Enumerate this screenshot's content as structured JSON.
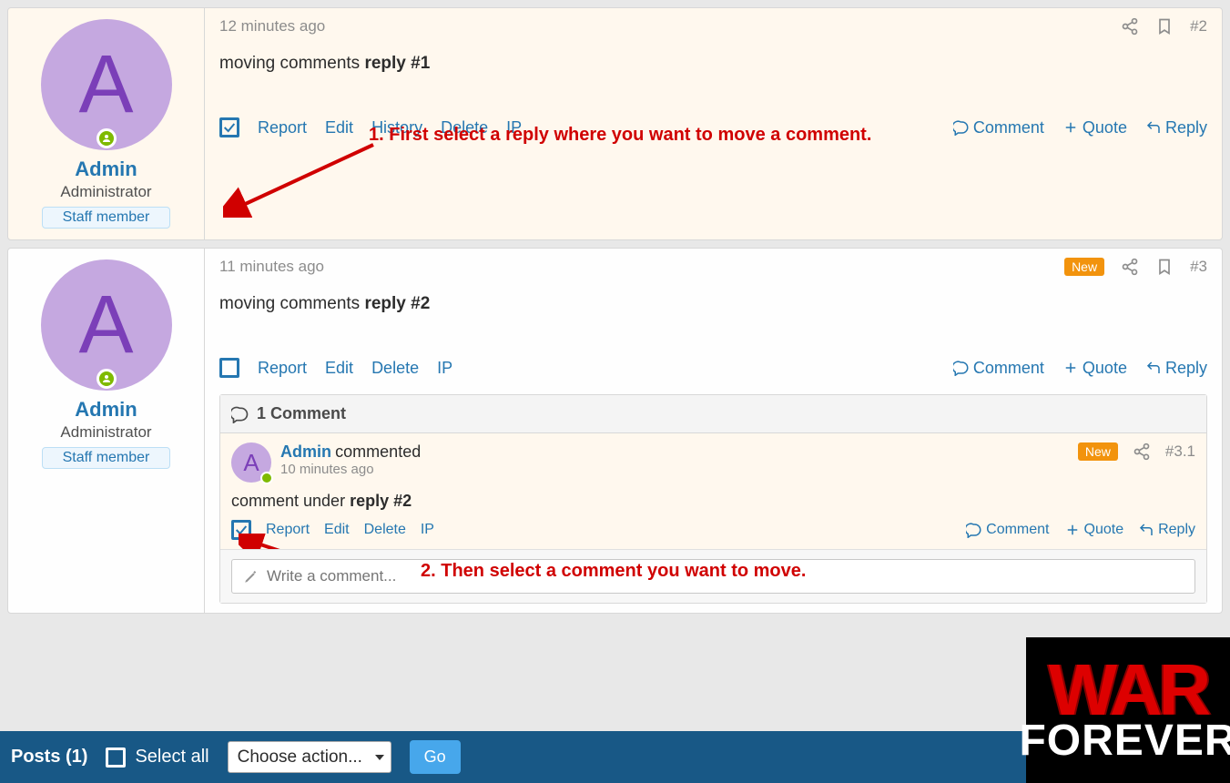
{
  "posts": [
    {
      "avatar_letter": "A",
      "username": "Admin",
      "usertitle": "Administrator",
      "staff_badge": "Staff member",
      "time": "12 minutes ago",
      "postnum": "#2",
      "new_badge": null,
      "body_prefix": "moving comments ",
      "body_bold": "reply #1",
      "checked": true,
      "actions_left": [
        "Report",
        "Edit",
        "History",
        "Delete",
        "IP"
      ],
      "actions_right": [
        {
          "icon": "comment",
          "label": "Comment"
        },
        {
          "icon": "plus",
          "label": "Quote"
        },
        {
          "icon": "reply",
          "label": "Reply"
        }
      ]
    },
    {
      "avatar_letter": "A",
      "username": "Admin",
      "usertitle": "Administrator",
      "staff_badge": "Staff member",
      "time": "11 minutes ago",
      "postnum": "#3",
      "new_badge": "New",
      "body_prefix": "moving comments ",
      "body_bold": "reply #2",
      "checked": false,
      "actions_left": [
        "Report",
        "Edit",
        "Delete",
        "IP"
      ],
      "actions_right": [
        {
          "icon": "comment",
          "label": "Comment"
        },
        {
          "icon": "plus",
          "label": "Quote"
        },
        {
          "icon": "reply",
          "label": "Reply"
        }
      ],
      "comments": {
        "header": "1 Comment",
        "items": [
          {
            "avatar_letter": "A",
            "author": "Admin",
            "commented_word": "commented",
            "time": "10 minutes ago",
            "new_badge": "New",
            "postnum": "#3.1",
            "body_prefix": "comment under ",
            "body_bold": "reply #2",
            "checked": true,
            "actions_left": [
              "Report",
              "Edit",
              "Delete",
              "IP"
            ],
            "actions_right": [
              {
                "icon": "comment",
                "label": "Comment"
              },
              {
                "icon": "plus",
                "label": "Quote"
              },
              {
                "icon": "reply",
                "label": "Reply"
              }
            ]
          }
        ],
        "input_placeholder": "Write a comment..."
      }
    }
  ],
  "annotations": {
    "a1": "1. First select a reply where you want to move a comment.",
    "a2": "2. Then select a comment you want to move."
  },
  "bottom_bar": {
    "posts_label": "Posts (1)",
    "select_all": "Select all",
    "action_placeholder": "Choose action...",
    "go": "Go"
  },
  "logo": {
    "line1": "WAR",
    "line2": "FOREVER"
  }
}
